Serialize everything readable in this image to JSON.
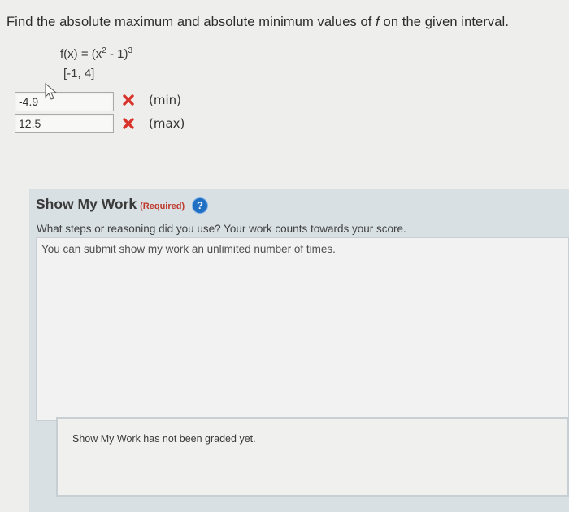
{
  "question": {
    "text_before": "Find the absolute maximum and absolute minimum values of ",
    "var": "f",
    "text_after": " on the given interval."
  },
  "function": {
    "lhs": "f(x) = (x",
    "exp1": "2",
    "mid": " - 1)",
    "exp2": "3"
  },
  "interval": "[-1, 4]",
  "answers": [
    {
      "value": "-4.9",
      "label": "(min)",
      "status": "incorrect"
    },
    {
      "value": "12.5",
      "label": "(max)",
      "status": "incorrect"
    }
  ],
  "show_my_work": {
    "title": "Show My Work",
    "required": "(Required)",
    "help_icon": "?",
    "description": "What steps or reasoning did you use? Your work counts towards your score.",
    "placeholder": "You can submit show my work an unlimited number of times.",
    "graded_status": "Show My Work has not been graded yet."
  },
  "colors": {
    "incorrect": "#d9342b",
    "help": "#1f6fc2"
  }
}
